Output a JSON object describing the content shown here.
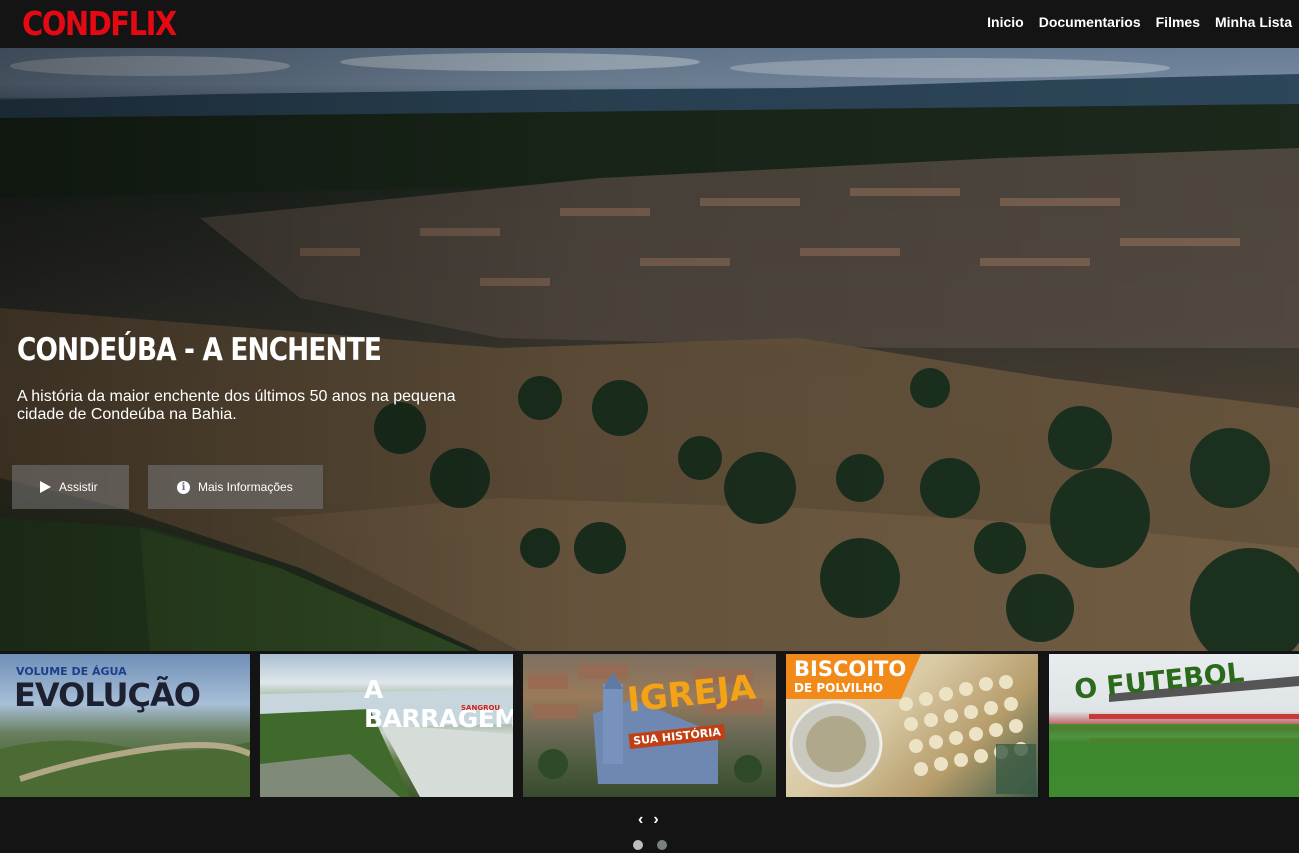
{
  "brand": {
    "logo": "CONDFLIX",
    "logo_color": "#e50914"
  },
  "nav": {
    "items": [
      "Inicio",
      "Documentarios",
      "Filmes",
      "Minha Lista"
    ]
  },
  "hero": {
    "title": "CONDEÚBA - A ENCHENTE",
    "description": "A história da maior enchente dos últimos 50 anos na pequena cidade de Condeúba na Bahia.",
    "play_label": "Assistir",
    "info_label": "Mais Informações",
    "info_glyph": "i"
  },
  "thumbnails": [
    {
      "caption_small": "VOLUME DE ÁGUA",
      "caption": "EVOLUÇÃO"
    },
    {
      "caption": "A BARRAGEM",
      "caption_small": "SANGROU"
    },
    {
      "caption": "IGREJA",
      "caption_small": "SUA HISTÓRIA"
    },
    {
      "caption": "BISCOITO",
      "caption_small": "DE POLVILHO"
    },
    {
      "caption": "O FUTEBOL"
    }
  ],
  "carousel": {
    "prev": "‹",
    "next": "›",
    "pages": 2,
    "active_page": 1
  }
}
